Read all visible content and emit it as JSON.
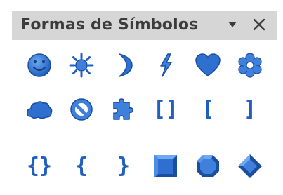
{
  "panel": {
    "title": "Formas de Símbolos",
    "dropdown_icon": "triangle-down-icon",
    "close_icon": "close-icon"
  },
  "colors": {
    "accent": "#1f5fbf",
    "accent_light": "#4a8ee8",
    "titlebar_bg": "#d6d6d6",
    "title_text": "#3c3c3c"
  },
  "symbols": [
    {
      "name": "smiley-face",
      "icon": "smiley-icon"
    },
    {
      "name": "sun",
      "icon": "sun-icon"
    },
    {
      "name": "moon",
      "icon": "moon-icon"
    },
    {
      "name": "lightning",
      "icon": "lightning-icon"
    },
    {
      "name": "heart",
      "icon": "heart-icon"
    },
    {
      "name": "flower",
      "icon": "flower-icon"
    },
    {
      "name": "cloud",
      "icon": "cloud-icon"
    },
    {
      "name": "prohibited",
      "icon": "prohibited-icon"
    },
    {
      "name": "puzzle",
      "icon": "puzzle-icon"
    },
    {
      "name": "double-bracket",
      "icon": "double-bracket-icon",
      "text": "[]"
    },
    {
      "name": "left-bracket",
      "icon": "left-bracket-icon",
      "text": "["
    },
    {
      "name": "right-bracket",
      "icon": "right-bracket-icon",
      "text": "]"
    },
    {
      "name": "double-brace",
      "icon": "double-brace-icon",
      "text": "{}"
    },
    {
      "name": "left-brace",
      "icon": "left-brace-icon",
      "text": "{"
    },
    {
      "name": "right-brace",
      "icon": "right-brace-icon",
      "text": "}"
    },
    {
      "name": "square-bevel",
      "icon": "square-bevel-icon"
    },
    {
      "name": "octagon-bevel",
      "icon": "octagon-bevel-icon"
    },
    {
      "name": "diamond-bevel",
      "icon": "diamond-bevel-icon"
    }
  ]
}
